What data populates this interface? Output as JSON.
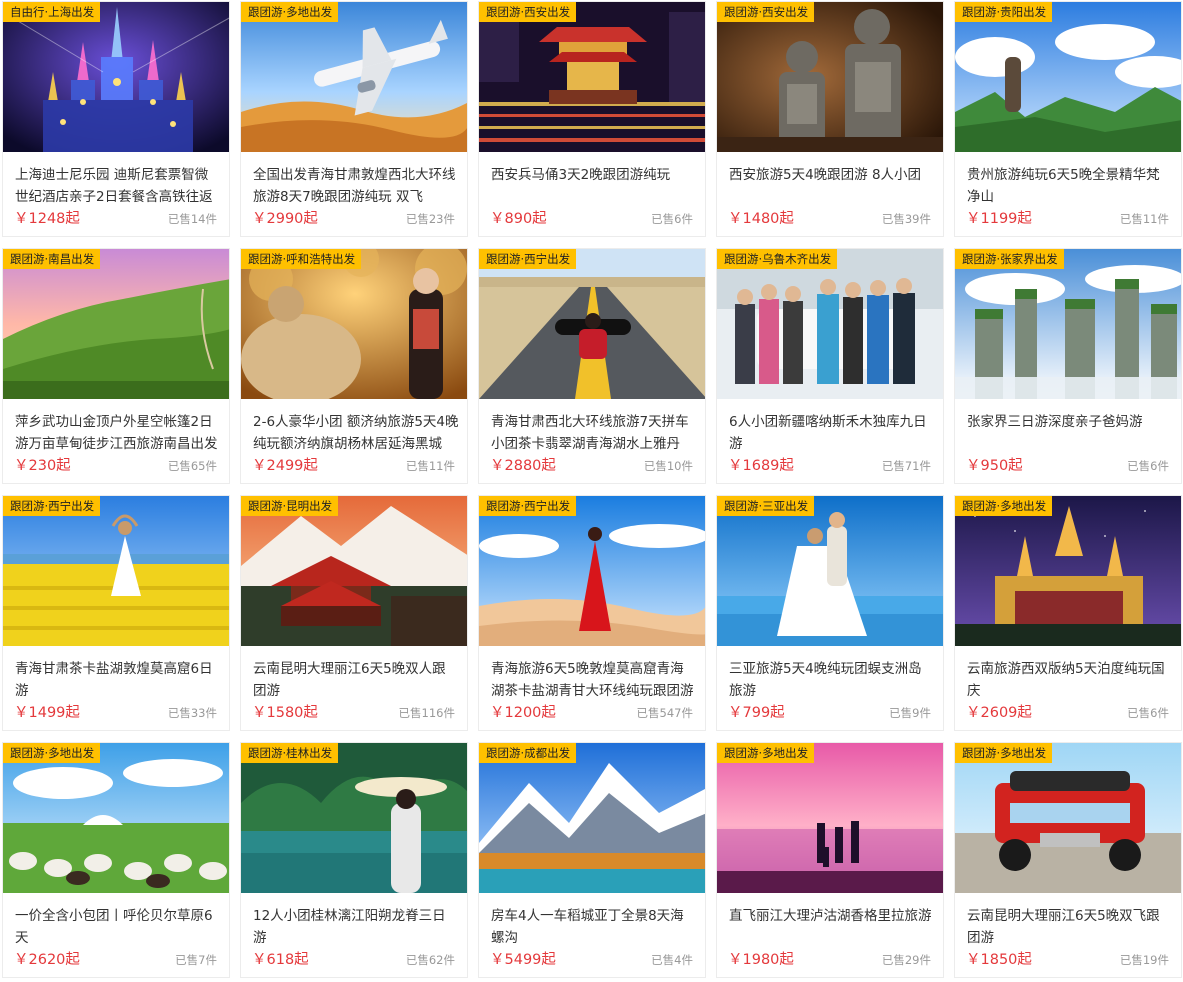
{
  "products": [
    {
      "tag": "自由行·上海出发",
      "title": "上海迪士尼乐园 迪斯尼套票智微世纪酒店亲子2日套餐含高铁往返",
      "price": "￥1248起",
      "sold": "已售14件",
      "scene": "castle"
    },
    {
      "tag": "跟团游·多地出发",
      "title": "全国出发青海甘肃敦煌西北大环线旅游8天7晚跟团游纯玩 双飞",
      "price": "￥2990起",
      "sold": "已售23件",
      "scene": "plane"
    },
    {
      "tag": "跟团游·西安出发",
      "title": "西安兵马俑3天2晚跟团游纯玩",
      "price": "￥890起",
      "sold": "已售6件",
      "scene": "xian"
    },
    {
      "tag": "跟团游·西安出发",
      "title": "西安旅游5天4晚跟团游 8人小团",
      "price": "￥1480起",
      "sold": "已售39件",
      "scene": "warriors"
    },
    {
      "tag": "跟团游·贵阳出发",
      "title": "贵州旅游纯玩6天5晚全景精华梵净山",
      "price": "￥1199起",
      "sold": "已售11件",
      "scene": "fanjing"
    },
    {
      "tag": "跟团游·南昌出发",
      "title": "萍乡武功山金顶户外星空帐篷2日游万亩草甸徒步江西旅游南昌出发",
      "price": "￥230起",
      "sold": "已售65件",
      "scene": "meadow"
    },
    {
      "tag": "跟团游·呼和浩特出发",
      "title": "2-6人豪华小团 额济纳旅游5天4晚纯玩额济纳旗胡杨林居延海黑城",
      "price": "￥2499起",
      "sold": "已售11件",
      "scene": "camel"
    },
    {
      "tag": "跟团游·西宁出发",
      "title": "青海甘肃西北大环线旅游7天拼车小团茶卡翡翠湖青海湖水上雅丹",
      "price": "￥2880起",
      "sold": "已售10件",
      "scene": "road"
    },
    {
      "tag": "跟团游·乌鲁木齐出发",
      "title": "6人小团新疆喀纳斯禾木独库九日游",
      "price": "￥1689起",
      "sold": "已售71件",
      "scene": "group"
    },
    {
      "tag": "跟团游·张家界出发",
      "title": "张家界三日游深度亲子爸妈游",
      "price": "￥950起",
      "sold": "已售6件",
      "scene": "zjj"
    },
    {
      "tag": "跟团游·西宁出发",
      "title": "青海甘肃茶卡盐湖敦煌莫高窟6日游",
      "price": "￥1499起",
      "sold": "已售33件",
      "scene": "rapeseed"
    },
    {
      "tag": "跟团游·昆明出发",
      "title": "云南昆明大理丽江6天5晚双人跟团游",
      "price": "￥1580起",
      "sold": "已售116件",
      "scene": "lijiang"
    },
    {
      "tag": "跟团游·西宁出发",
      "title": "青海旅游6天5晚敦煌莫高窟青海湖茶卡盐湖青甘大环线纯玩跟团游",
      "price": "￥1200起",
      "sold": "已售547件",
      "scene": "desert"
    },
    {
      "tag": "跟团游·三亚出发",
      "title": "三亚旅游5天4晚纯玩团蜈支洲岛旅游",
      "price": "￥799起",
      "sold": "已售9件",
      "scene": "wedding"
    },
    {
      "tag": "跟团游·多地出发",
      "title": "云南旅游西双版纳5天泊度纯玩国庆",
      "price": "￥2609起",
      "sold": "已售6件",
      "scene": "temple"
    },
    {
      "tag": "跟团游·多地出发",
      "title": "一价全含小包团丨呼伦贝尔草原6天",
      "price": "￥2620起",
      "sold": "已售7件",
      "scene": "sheep"
    },
    {
      "tag": "跟团游·桂林出发",
      "title": "12人小团桂林漓江阳朔龙脊三日游",
      "price": "￥618起",
      "sold": "已售62件",
      "scene": "guilin"
    },
    {
      "tag": "跟团游·成都出发",
      "title": "房车4人一车稻城亚丁全景8天海螺沟",
      "price": "￥5499起",
      "sold": "已售4件",
      "scene": "daocheng"
    },
    {
      "tag": "跟团游·多地出发",
      "title": "直飞丽江大理泸沽湖香格里拉旅游",
      "price": "￥1980起",
      "sold": "已售29件",
      "scene": "sunset"
    },
    {
      "tag": "跟团游·多地出发",
      "title": "云南昆明大理丽江6天5晚双飞跟团游",
      "price": "￥1850起",
      "sold": "已售19件",
      "scene": "jeep"
    }
  ]
}
